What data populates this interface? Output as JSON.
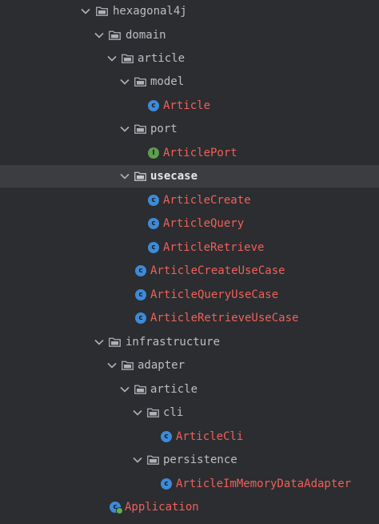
{
  "project_tree": {
    "root": {
      "label": "hexagonal4j"
    },
    "domain": {
      "label": "domain"
    },
    "domain_article": {
      "label": "article"
    },
    "model": {
      "label": "model"
    },
    "model_article": {
      "label": "Article",
      "kind": "class",
      "icon_text": "c"
    },
    "port": {
      "label": "port"
    },
    "article_port": {
      "label": "ArticlePort",
      "kind": "interface",
      "icon_text": "I"
    },
    "usecase": {
      "label": "usecase"
    },
    "article_create": {
      "label": "ArticleCreate",
      "kind": "class",
      "icon_text": "c"
    },
    "article_query": {
      "label": "ArticleQuery",
      "kind": "class",
      "icon_text": "c"
    },
    "article_retrieve": {
      "label": "ArticleRetrieve",
      "kind": "class",
      "icon_text": "c"
    },
    "article_create_use_case": {
      "label": "ArticleCreateUseCase",
      "kind": "class",
      "icon_text": "c"
    },
    "article_query_use_case": {
      "label": "ArticleQueryUseCase",
      "kind": "class",
      "icon_text": "c"
    },
    "article_retrieve_use_case": {
      "label": "ArticleRetrieveUseCase",
      "kind": "class",
      "icon_text": "c"
    },
    "infrastructure": {
      "label": "infrastructure"
    },
    "adapter": {
      "label": "adapter"
    },
    "adapter_article": {
      "label": "article"
    },
    "cli": {
      "label": "cli"
    },
    "article_cli": {
      "label": "ArticleCli",
      "kind": "class",
      "icon_text": "c"
    },
    "persistence": {
      "label": "persistence"
    },
    "article_im_memory_data_adapter": {
      "label": "ArticleImMemoryDataAdapter",
      "kind": "class",
      "icon_text": "c"
    },
    "application": {
      "label": "Application",
      "kind": "application",
      "icon_text": "c"
    },
    "selected": "usecase"
  },
  "colors": {
    "background": "#2b2d30",
    "selection": "#3b3d41",
    "folder_text": "#bcbec4",
    "file_text": "#f0605a",
    "class_icon": "#3d8bd9",
    "interface_icon": "#5e9e4f"
  }
}
